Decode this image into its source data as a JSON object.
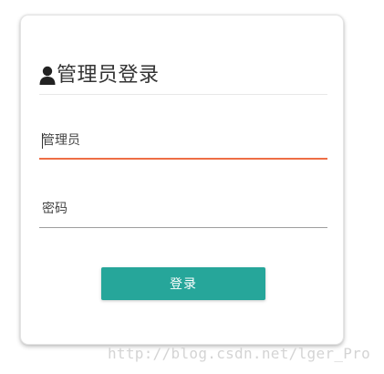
{
  "login_form": {
    "title": "管理员登录",
    "title_icon": "user-icon",
    "username_field": {
      "placeholder": "管理员",
      "value": ""
    },
    "password_field": {
      "placeholder": "密码",
      "value": ""
    },
    "submit_label": "登录"
  },
  "watermark": {
    "text": "http://blog.csdn.net/lger_Pro"
  },
  "colors": {
    "active_underline": "#ee6e45",
    "inactive_underline": "#9e9e9e",
    "button_background": "#26a69a",
    "button_text": "#ffffff",
    "title_text": "#333333"
  }
}
